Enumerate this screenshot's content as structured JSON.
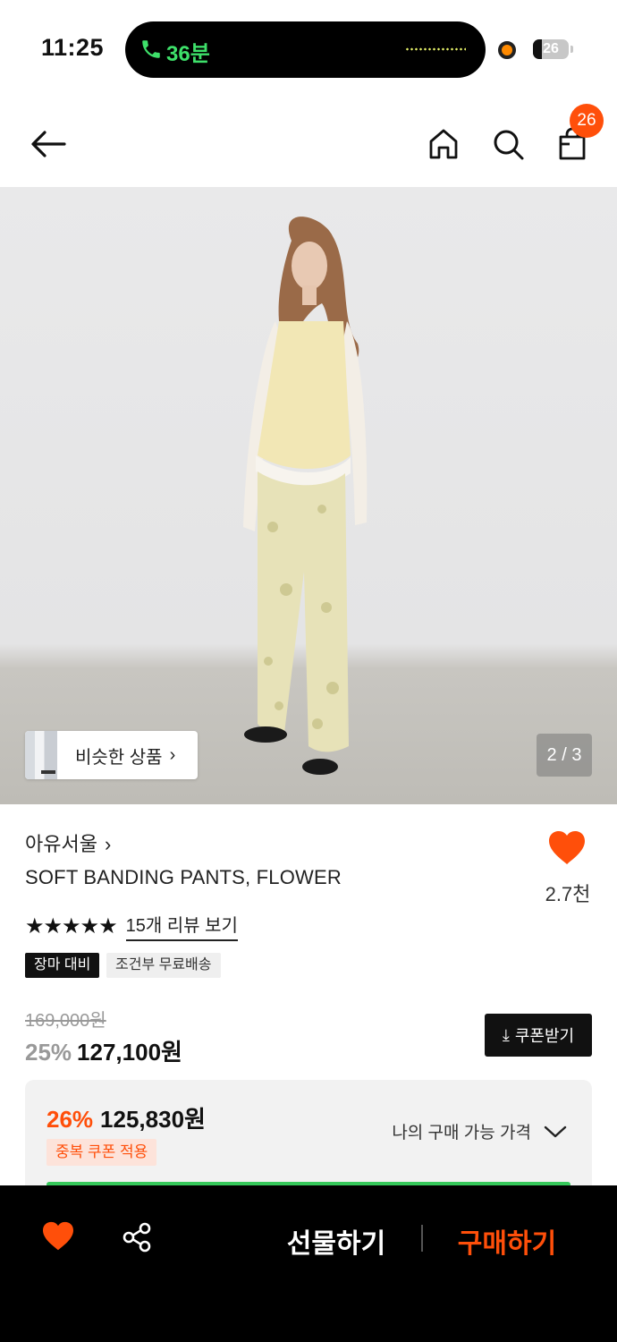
{
  "status_bar": {
    "time": "11:25",
    "call_duration": "36분",
    "battery_level": "26",
    "battery_fraction": 0.26
  },
  "nav": {
    "icons": [
      "back-arrow-icon",
      "home-icon",
      "search-icon",
      "shopping-bag-icon"
    ],
    "cart_count": "26"
  },
  "gallery": {
    "similar_label": "비슷한 상품",
    "counter": "2 / 3"
  },
  "product": {
    "brand": "아유서울",
    "name": "SOFT BANDING PANTS, FLOWER",
    "likes": "2.7천",
    "stars": "★★★★★",
    "review_link": "15개 리뷰 보기",
    "tags": [
      "장마 대비",
      "조건부 무료배송"
    ],
    "original_price": "169,000원",
    "discount_rate": "25%",
    "sale_price": "127,100원",
    "coupon_button": "쿠폰받기"
  },
  "best_price": {
    "discount_rate": "26%",
    "price": "125,830원",
    "badge": "중복 쿠폰 적용",
    "toggle_label": "나의 구매 가능 가격"
  },
  "bottom_bar": {
    "gift_label": "선물하기",
    "buy_label": "구매하기"
  },
  "colors": {
    "accent": "#ff4f0a",
    "green": "#35c85a",
    "dark": "#111111"
  }
}
